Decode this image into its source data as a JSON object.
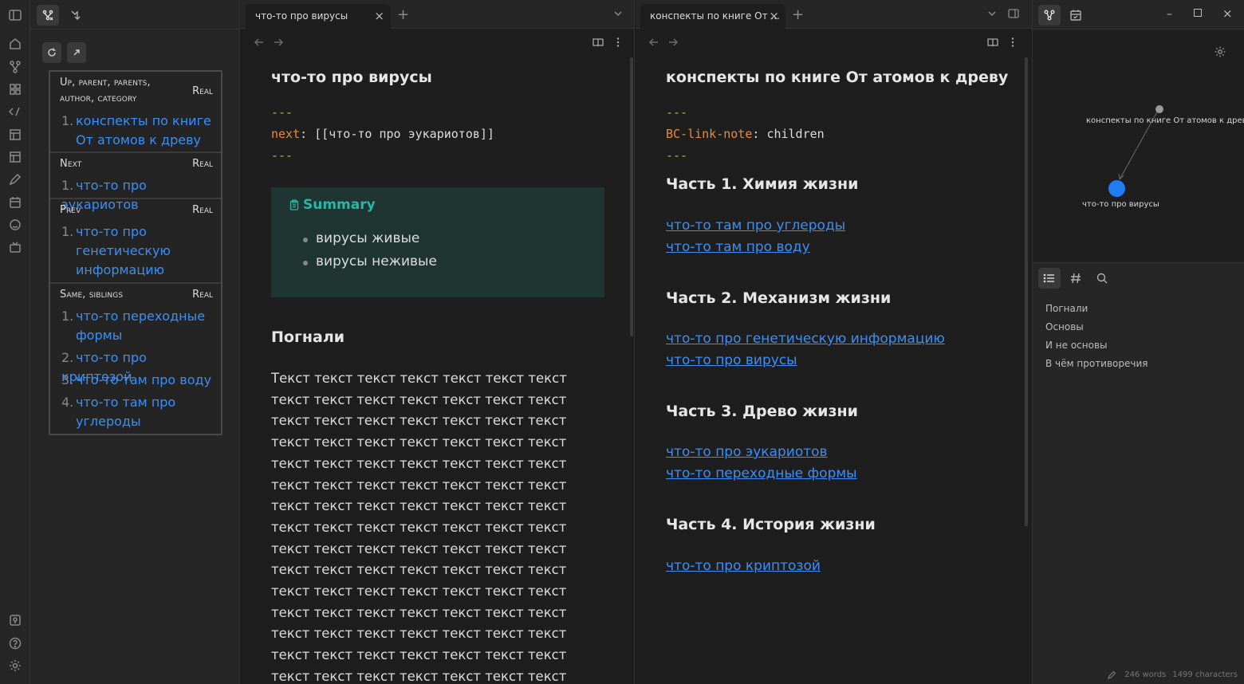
{
  "left_sidebar": {
    "matrix": {
      "sections": [
        {
          "label_line1": "Up, parent, parents,",
          "label_line2": "author, category",
          "kind": "Real",
          "items": [
            {
              "num": "1.",
              "line1": "конспекты по книге",
              "line2": "От атомов к древу"
            }
          ]
        },
        {
          "label_line1": "Next",
          "kind": "Real",
          "items": [
            {
              "num": "1.",
              "line1": "что-то про эукариотов"
            }
          ]
        },
        {
          "label_line1": "Prev",
          "kind": "Real",
          "items": [
            {
              "num": "1.",
              "line1": "что-то про",
              "line2": "генетическую",
              "line3": "информацию"
            }
          ]
        },
        {
          "label_line1": "Same, siblings",
          "kind": "Real",
          "items": [
            {
              "num": "1.",
              "line1": "что-то переходные",
              "line2": "формы"
            },
            {
              "num": "2.",
              "line1": "что-то про криптозой"
            },
            {
              "num": "3.",
              "line1": "что-то там про воду"
            },
            {
              "num": "4.",
              "line1": "что-то там про",
              "line2": "углероды"
            }
          ]
        }
      ]
    }
  },
  "pane1": {
    "tab_title": "что-то про вирусы",
    "note_title": "что-то про вирусы",
    "frontmatter": {
      "dash": "---",
      "key": "next",
      "value": "[[что-то про эукариотов]]"
    },
    "callout": {
      "title": "Summary",
      "items": [
        "вирусы живые",
        "вирусы неживые"
      ]
    },
    "heading": "Погнали",
    "paragraph": "Текст текст текст текст текст текст текст текст текст текст текст текст текст текст текст текст текст текст текст текст текст текст текст текст текст текст текст текст текст текст текст текст текст текст текст текст текст текст текст текст текст текст текст текст текст текст текст текст текст текст текст текст текст текст текст текст текст текст текст текст текст текст текст текст текст текст текст текст текст текст текст текст текст текст текст текст текст текст текст текст текст текст текст текст текст текст текст текст текст текст текст текст текст текст текст текст текст текст текст текст текст текст текст текст текст текст текст текст текст текст текст текст текст текст текст текст текст текст текст текст текст текст текст текст"
  },
  "pane2": {
    "tab_title": "конспекты по книге От ...",
    "note_title": "конспекты по книге От атомов к древу",
    "frontmatter": {
      "dash": "---",
      "key": "BC-link-note",
      "value": "children"
    },
    "parts": [
      {
        "heading": "Часть 1. Химия жизни",
        "links": [
          "что-то там про углероды",
          "что-то там про воду"
        ]
      },
      {
        "heading": "Часть 2. Механизм жизни",
        "links": [
          "что-то про генетическую информацию",
          "что-то про вирусы"
        ]
      },
      {
        "heading": "Часть 3. Древо жизни",
        "links": [
          "что-то про эукариотов",
          "что-то переходные формы"
        ]
      },
      {
        "heading": "Часть 4. История жизни",
        "links": [
          "что-то про криптозой"
        ]
      }
    ]
  },
  "right_sidebar": {
    "graph": {
      "nodes": [
        {
          "label": "конспекты по книге От атомов к древу",
          "color": "#9a9a9a"
        },
        {
          "label": "что-то про вирусы",
          "color": "#1f7cf2"
        }
      ]
    },
    "outline": [
      "Погнали",
      "Основы",
      "И не основы",
      "В чём противоречия"
    ],
    "status": {
      "words": "246 words",
      "chars": "1499 characters"
    }
  },
  "colors": {
    "accent_link": "#3b8ff5",
    "callout_bg": "#1f3532",
    "callout_title": "#2bb5a8",
    "frontmatter_dash": "#9bc425",
    "frontmatter_key": "#e28b3c"
  }
}
